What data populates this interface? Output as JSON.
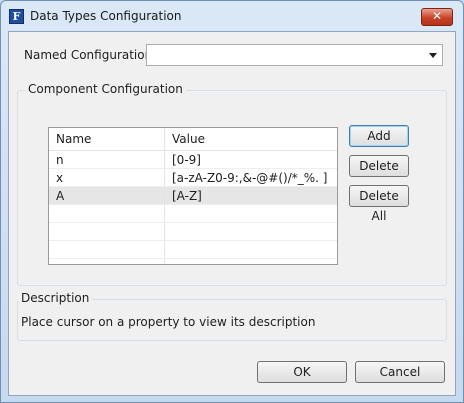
{
  "window": {
    "title": "Data Types Configuration",
    "close_glyph": "✕"
  },
  "named_config": {
    "label": "Named Configuration",
    "value": ""
  },
  "component_config": {
    "title": "Component Configuration",
    "columns": [
      "Name",
      "Value"
    ],
    "rows": [
      {
        "name": "n",
        "value": "[0-9]"
      },
      {
        "name": "x",
        "value": "[a-zA-Z0-9:,&-@#()/*_%. ]"
      },
      {
        "name": "A",
        "value": "[A-Z]"
      }
    ],
    "selected_row": 2,
    "buttons": {
      "add": "Add",
      "delete": "Delete",
      "delete_all": "Delete All"
    }
  },
  "description": {
    "title": "Description",
    "text": "Place cursor on a property to view its description"
  },
  "footer": {
    "ok": "OK",
    "cancel": "Cancel"
  }
}
